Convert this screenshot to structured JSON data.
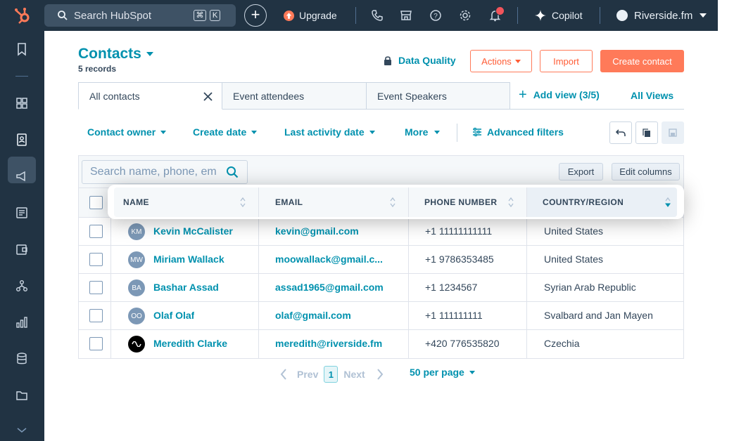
{
  "topbar": {
    "search_placeholder": "Search HubSpot",
    "kbd_cmd": "⌘",
    "kbd_k": "K",
    "upgrade_label": "Upgrade",
    "copilot_label": "Copilot",
    "account_label": "Riverside.fm",
    "notification_count": ""
  },
  "header": {
    "title": "Contacts",
    "records": "5 records",
    "data_quality": "Data Quality",
    "actions": "Actions",
    "import": "Import",
    "create_contact": "Create contact"
  },
  "tabs": [
    {
      "label": "All contacts"
    },
    {
      "label": "Event attendees"
    },
    {
      "label": "Event Speakers"
    }
  ],
  "add_view": "Add view (3/5)",
  "all_views": "All Views",
  "filters": {
    "contact_owner": "Contact owner",
    "create_date": "Create date",
    "last_activity_date": "Last activity date",
    "more": "More",
    "advanced_filters": "Advanced filters"
  },
  "table": {
    "search_placeholder": "Search name, phone, em",
    "export": "Export",
    "edit_columns": "Edit columns",
    "columns": [
      "NAME",
      "EMAIL",
      "PHONE NUMBER",
      "COUNTRY/REGION"
    ],
    "rows": [
      {
        "initials": "KM",
        "name": "Kevin McCalister",
        "email": "kevin@gmail.com",
        "phone": "+1 11111111111",
        "country": "United States"
      },
      {
        "initials": "MW",
        "name": "Miriam Wallack",
        "email": "moowallack@gmail.c...",
        "phone": "+1 9786353485",
        "country": "United States"
      },
      {
        "initials": "BA",
        "name": "Bashar Assad",
        "email": "assad1965@gmail.com",
        "phone": "+1 1234567",
        "country": "Syrian Arab Republic"
      },
      {
        "initials": "OO",
        "name": "Olaf Olaf",
        "email": "olaf@gmail.com",
        "phone": "+1 111111111",
        "country": "Svalbard and Jan Mayen"
      },
      {
        "initials": "",
        "name": "Meredith Clarke",
        "email": "meredith@riverside.fm",
        "phone": "+420 776535820",
        "country": "Czechia"
      }
    ]
  },
  "pagination": {
    "prev": "Prev",
    "page": "1",
    "next": "Next",
    "per_page": "50 per page"
  },
  "colors": {
    "accent": "#0091ae",
    "orange": "#ff7a59",
    "nav_bg": "#213343"
  }
}
